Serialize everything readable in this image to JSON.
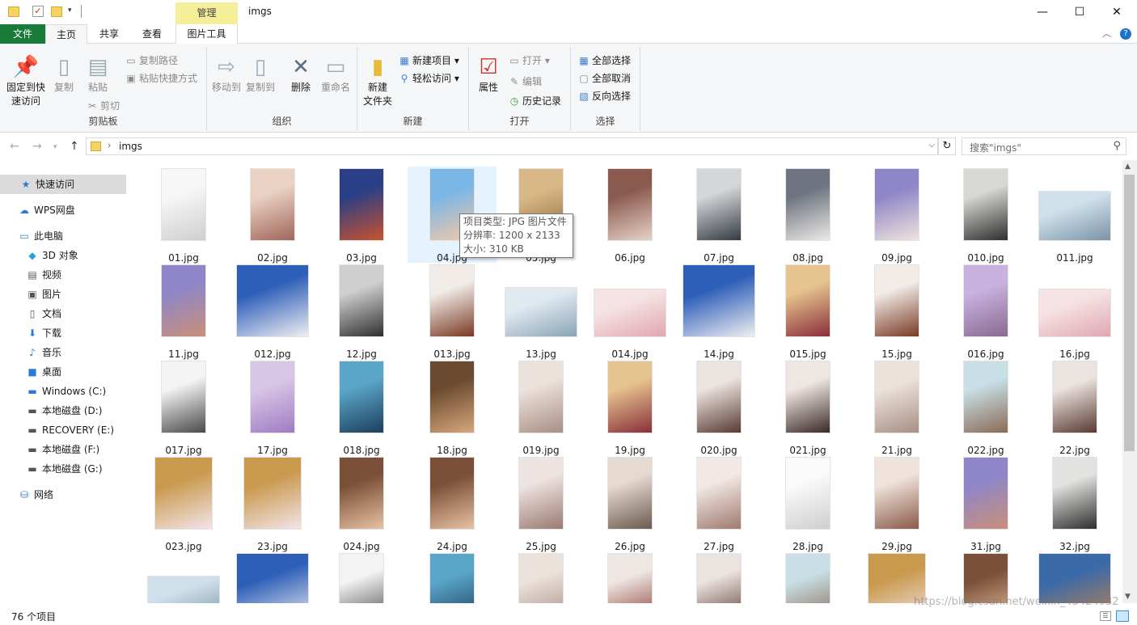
{
  "window": {
    "context_tab": "管理",
    "title": "imgs",
    "minimize": "—",
    "maximize": "☐",
    "close": "✕"
  },
  "tabs": {
    "file": "文件",
    "home": "主页",
    "share": "共享",
    "view": "查看",
    "picture_tools": "图片工具"
  },
  "ribbon": {
    "clipboard": {
      "label": "剪贴板",
      "pin": "固定到快\n速访问",
      "copy": "复制",
      "paste": "粘贴",
      "copy_path": "复制路径",
      "paste_shortcut": "粘贴快捷方式",
      "cut": "剪切"
    },
    "organize": {
      "label": "组织",
      "move_to": "移动到",
      "copy_to": "复制到",
      "delete": "删除",
      "rename": "重命名"
    },
    "new": {
      "label": "新建",
      "new_folder": "新建\n文件夹",
      "new_item": "新建项目",
      "easy_access": "轻松访问"
    },
    "open": {
      "label": "打开",
      "properties": "属性",
      "open": "打开",
      "edit": "编辑",
      "history": "历史记录"
    },
    "select": {
      "label": "选择",
      "select_all": "全部选择",
      "select_none": "全部取消",
      "invert": "反向选择"
    }
  },
  "address": {
    "path": "imgs",
    "search_placeholder": "搜索\"imgs\""
  },
  "nav": [
    {
      "label": "快速访问",
      "icon": "star-icon",
      "glyph": "★",
      "color": "#2b7bd6"
    },
    {
      "label": "WPS网盘",
      "icon": "cloud-icon",
      "glyph": "☁",
      "color": "#2b7bd6"
    },
    {
      "label": "此电脑",
      "icon": "computer-icon",
      "glyph": "▭",
      "color": "#2b7bd6"
    },
    {
      "label": "3D 对象",
      "icon": "cube-icon",
      "glyph": "◆",
      "color": "#26a0da"
    },
    {
      "label": "视频",
      "icon": "video-icon",
      "glyph": "▤",
      "color": "#555"
    },
    {
      "label": "图片",
      "icon": "picture-icon",
      "glyph": "▣",
      "color": "#555"
    },
    {
      "label": "文档",
      "icon": "document-icon",
      "glyph": "▯",
      "color": "#555"
    },
    {
      "label": "下载",
      "icon": "download-icon",
      "glyph": "⬇",
      "color": "#2b7bd6"
    },
    {
      "label": "音乐",
      "icon": "music-icon",
      "glyph": "♪",
      "color": "#2b7bd6"
    },
    {
      "label": "桌面",
      "icon": "desktop-icon",
      "glyph": "■",
      "color": "#2b7bd6"
    },
    {
      "label": "Windows (C:)",
      "icon": "drive-icon",
      "glyph": "▬",
      "color": "#2b7bd6"
    },
    {
      "label": "本地磁盘 (D:)",
      "icon": "drive-icon",
      "glyph": "▬",
      "color": "#555"
    },
    {
      "label": "RECOVERY (E:)",
      "icon": "drive-icon",
      "glyph": "▬",
      "color": "#555"
    },
    {
      "label": "本地磁盘 (F:)",
      "icon": "drive-icon",
      "glyph": "▬",
      "color": "#555"
    },
    {
      "label": "本地磁盘 (G:)",
      "icon": "drive-icon",
      "glyph": "▬",
      "color": "#555"
    },
    {
      "label": "网络",
      "icon": "network-icon",
      "glyph": "⛁",
      "color": "#2b7bd6"
    }
  ],
  "files": [
    {
      "name": "01.jpg",
      "c": [
        "#f7f7f7",
        "#cfcfcf"
      ],
      "shape": "portrait"
    },
    {
      "name": "02.jpg",
      "c": [
        "#e9d2c3",
        "#a0665a"
      ],
      "shape": "portrait"
    },
    {
      "name": "03.jpg",
      "c": [
        "#2a3f86",
        "#c9522e"
      ],
      "shape": "portrait"
    },
    {
      "name": "04.jpg",
      "c": [
        "#7ab6e6",
        "#f2c9a8"
      ],
      "shape": "portrait",
      "selected": true
    },
    {
      "name": "05.jpg",
      "c": [
        "#d9b887",
        "#8a6a3e"
      ],
      "shape": "portrait"
    },
    {
      "name": "06.jpg",
      "c": [
        "#8a5a4e",
        "#e6d2c8"
      ],
      "shape": "portrait"
    },
    {
      "name": "07.jpg",
      "c": [
        "#d4d6d8",
        "#353b44"
      ],
      "shape": "portrait"
    },
    {
      "name": "08.jpg",
      "c": [
        "#6e7580",
        "#ece9e6"
      ],
      "shape": "portrait"
    },
    {
      "name": "09.jpg",
      "c": [
        "#8e86c8",
        "#f0e3dd"
      ],
      "shape": "portrait"
    },
    {
      "name": "010.jpg",
      "c": [
        "#d7d7d3",
        "#2f2f2f"
      ],
      "shape": "portrait"
    },
    {
      "name": "011.jpg",
      "c": [
        "#cfe0ea",
        "#7a93a8"
      ],
      "shape": "landscape"
    },
    {
      "name": "11.jpg",
      "c": [
        "#8e86c8",
        "#c98f7a"
      ],
      "shape": "portrait"
    },
    {
      "name": "012.jpg",
      "c": [
        "#2e5fb8",
        "#f0eef2"
      ],
      "shape": "square"
    },
    {
      "name": "12.jpg",
      "c": [
        "#cfcfcf",
        "#303030"
      ],
      "shape": "portrait"
    },
    {
      "name": "013.jpg",
      "c": [
        "#f1ece8",
        "#7a3a24"
      ],
      "shape": "portrait"
    },
    {
      "name": "13.jpg",
      "c": [
        "#dfe9ef",
        "#8aa4b7"
      ],
      "shape": "landscape"
    },
    {
      "name": "014.jpg",
      "c": [
        "#f6e2e4",
        "#e0a7b2"
      ],
      "shape": "landscape-low"
    },
    {
      "name": "14.jpg",
      "c": [
        "#2e5fb8",
        "#f0eef2"
      ],
      "shape": "square"
    },
    {
      "name": "015.jpg",
      "c": [
        "#e6c48f",
        "#8a2e3a"
      ],
      "shape": "portrait"
    },
    {
      "name": "15.jpg",
      "c": [
        "#f1ece8",
        "#7a3a24"
      ],
      "shape": "portrait"
    },
    {
      "name": "016.jpg",
      "c": [
        "#c9b2e0",
        "#8a6a90"
      ],
      "shape": "portrait"
    },
    {
      "name": "16.jpg",
      "c": [
        "#f6e2e4",
        "#e0a7b2"
      ],
      "shape": "landscape-low"
    },
    {
      "name": "017.jpg",
      "c": [
        "#f3f3f3",
        "#4a4a4a"
      ],
      "shape": "portrait"
    },
    {
      "name": "17.jpg",
      "c": [
        "#d8c6e6",
        "#a07bc4"
      ],
      "shape": "portrait"
    },
    {
      "name": "018.jpg",
      "c": [
        "#5aa6c9",
        "#1d3e5c"
      ],
      "shape": "portrait"
    },
    {
      "name": "18.jpg",
      "c": [
        "#6a4a30",
        "#d7a77a"
      ],
      "shape": "portrait"
    },
    {
      "name": "019.jpg",
      "c": [
        "#ece2dc",
        "#a88f84"
      ],
      "shape": "portrait"
    },
    {
      "name": "19.jpg",
      "c": [
        "#e6c48f",
        "#8a2e3a"
      ],
      "shape": "portrait"
    },
    {
      "name": "020.jpg",
      "c": [
        "#ebe3df",
        "#5a3a33"
      ],
      "shape": "portrait"
    },
    {
      "name": "021.jpg",
      "c": [
        "#eee6e2",
        "#3a2a28"
      ],
      "shape": "portrait"
    },
    {
      "name": "21.jpg",
      "c": [
        "#ece2dc",
        "#a88f84"
      ],
      "shape": "portrait"
    },
    {
      "name": "022.jpg",
      "c": [
        "#c8dfe6",
        "#8a6a55"
      ],
      "shape": "portrait"
    },
    {
      "name": "22.jpg",
      "c": [
        "#ebe3df",
        "#5a3a33"
      ],
      "shape": "portrait"
    },
    {
      "name": "023.jpg",
      "c": [
        "#c99a4e",
        "#f3e4ea"
      ],
      "shape": "landscape-tall"
    },
    {
      "name": "23.jpg",
      "c": [
        "#c99a4e",
        "#f3e4ea"
      ],
      "shape": "landscape-tall"
    },
    {
      "name": "024.jpg",
      "c": [
        "#7a5038",
        "#e8c2a2"
      ],
      "shape": "portrait"
    },
    {
      "name": "24.jpg",
      "c": [
        "#7a5038",
        "#e8c2a2"
      ],
      "shape": "portrait"
    },
    {
      "name": "25.jpg",
      "c": [
        "#ede3e0",
        "#9a7a70"
      ],
      "shape": "portrait"
    },
    {
      "name": "26.jpg",
      "c": [
        "#e6d9cf",
        "#6a5a50"
      ],
      "shape": "portrait"
    },
    {
      "name": "27.jpg",
      "c": [
        "#f2e9e5",
        "#a07a6e"
      ],
      "shape": "portrait"
    },
    {
      "name": "28.jpg",
      "c": [
        "#fafafa",
        "#cfcfcf"
      ],
      "shape": "portrait"
    },
    {
      "name": "29.jpg",
      "c": [
        "#efe2da",
        "#8a5a48"
      ],
      "shape": "portrait"
    },
    {
      "name": "31.jpg",
      "c": [
        "#8e86c8",
        "#c98f7a"
      ],
      "shape": "portrait"
    },
    {
      "name": "32.jpg",
      "c": [
        "#e2e2e0",
        "#2e2e2e"
      ],
      "shape": "portrait"
    },
    {
      "name": "",
      "c": [
        "#cfe0ea",
        "#7a93a8"
      ],
      "shape": "landscape"
    },
    {
      "name": "",
      "c": [
        "#2e5fb8",
        "#f0eef2"
      ],
      "shape": "square"
    },
    {
      "name": "",
      "c": [
        "#f3f3f3",
        "#4a4a4a"
      ],
      "shape": "portrait"
    },
    {
      "name": "",
      "c": [
        "#5aa6c9",
        "#1d3e5c"
      ],
      "shape": "portrait"
    },
    {
      "name": "",
      "c": [
        "#ece2dc",
        "#a88f84"
      ],
      "shape": "portrait"
    },
    {
      "name": "",
      "c": [
        "#eee6e2",
        "#8a3a30"
      ],
      "shape": "portrait"
    },
    {
      "name": "",
      "c": [
        "#ebe3df",
        "#5a3a33"
      ],
      "shape": "portrait"
    },
    {
      "name": "",
      "c": [
        "#c8dfe6",
        "#8a6a55"
      ],
      "shape": "portrait"
    },
    {
      "name": "",
      "c": [
        "#c99a4e",
        "#f3e4ea"
      ],
      "shape": "landscape-tall"
    },
    {
      "name": "",
      "c": [
        "#7a5038",
        "#e8c2a2"
      ],
      "shape": "portrait"
    },
    {
      "name": "",
      "c": [
        "#3a6aa8",
        "#c8824a"
      ],
      "shape": "square"
    }
  ],
  "tooltip": {
    "type": "项目类型: JPG 图片文件",
    "resolution": "分辨率: 1200 x 2133",
    "size": "大小: 310 KB"
  },
  "status": {
    "count": "76 个项目"
  },
  "watermark": "https://blog.csdn.net/weixin_43424932"
}
